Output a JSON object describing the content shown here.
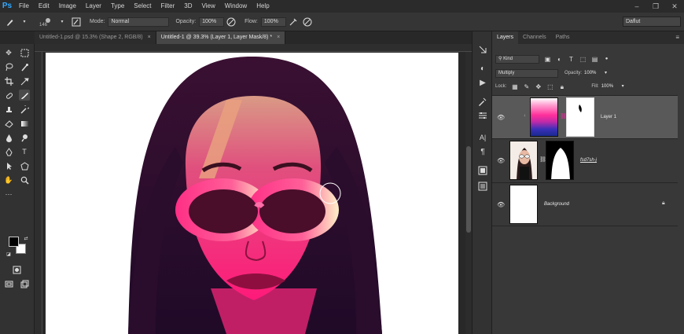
{
  "app": {
    "logo": "Ps"
  },
  "menu": [
    "File",
    "Edit",
    "Image",
    "Layer",
    "Type",
    "Select",
    "Filter",
    "3D",
    "View",
    "Window",
    "Help"
  ],
  "window_controls": [
    "–",
    "❐",
    "✕"
  ],
  "options": {
    "brush_size": "146",
    "mode_label": "Mode:",
    "mode_value": "Normal",
    "opacity_label": "Opacity:",
    "opacity_value": "100%",
    "flow_label": "Flow:",
    "flow_value": "100%",
    "workspace": "Daflut"
  },
  "tabs": [
    {
      "label": "Untitled-1.psd @ 15.3% (Shape 2, RGB/8)",
      "close": "×",
      "active": false
    },
    {
      "label": "Untitled-1 @ 39.3% (Layer 1, Layer Mask/8) *",
      "close": "×",
      "active": true
    }
  ],
  "layers_panel": {
    "tabs": [
      "Layers",
      "Channels",
      "Paths"
    ],
    "kind_value": "Kind",
    "blend_mode": "Multiply",
    "opacity_label": "Opacity:",
    "opacity_value": "100%",
    "lock_label": "Lock:",
    "fill_label": "Fill:",
    "fill_value": "100%",
    "layers": [
      {
        "name": "Layer 1",
        "selected": true,
        "has_mask": true
      },
      {
        "name": "fsd7sh-j",
        "selected": false,
        "has_mask": true
      },
      {
        "name": "Background",
        "selected": false,
        "locked": true
      }
    ]
  },
  "colors": {
    "accent": "#31a8ff",
    "gradient_top": "#ff3fa4",
    "gradient_bottom": "#1c2fb0"
  }
}
